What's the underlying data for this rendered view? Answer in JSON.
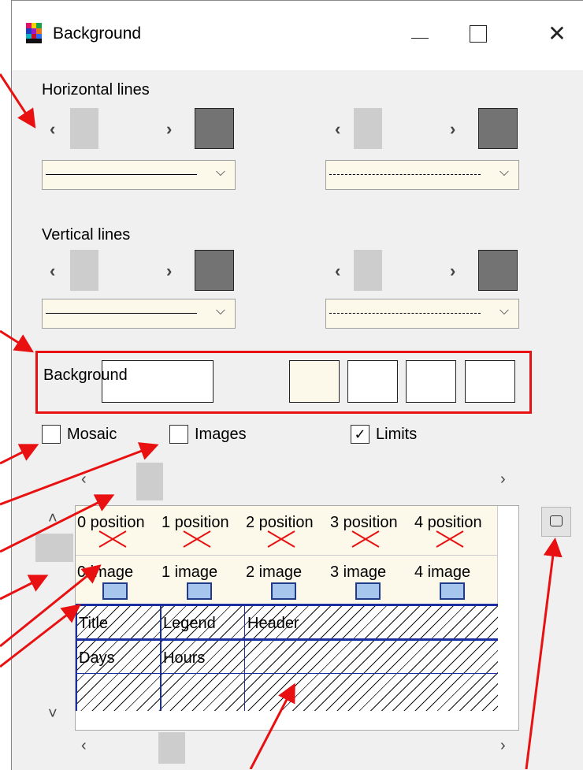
{
  "window": {
    "title": "Background"
  },
  "sections": {
    "horizontal_label": "Horizontal lines",
    "vertical_label": "Vertical lines",
    "background_label": "Background"
  },
  "checkboxes": {
    "mosaic": {
      "label": "Mosaic",
      "checked": false
    },
    "images": {
      "label": "Images",
      "checked": false
    },
    "limits": {
      "label": "Limits",
      "checked": true,
      "mark": "✓"
    }
  },
  "arrows": {
    "left": "‹",
    "right": "›",
    "up": "˄",
    "down": "˅",
    "chevron": "⌵"
  },
  "grid": {
    "position_row": [
      "0 position",
      "1 position",
      "2 position",
      "3 position",
      "4 position"
    ],
    "image_row": [
      "0 image",
      "1 image",
      "2 image",
      "3 image",
      "4 image"
    ],
    "text_rows": [
      [
        "Title",
        "Legend",
        "Header",
        "",
        ""
      ],
      [
        "Days",
        "Hours",
        "",
        "",
        ""
      ]
    ]
  },
  "colors": {
    "accent_red": "#e81010",
    "swatch_gray": "#737373",
    "combo_fill": "#fdf9ea",
    "grid_line_blue": "#1a2ea0"
  },
  "icons": {
    "app": "app-icon",
    "minimize": "minimize-icon",
    "maximize": "maximize-icon",
    "close": "close-icon",
    "side_button": "window-icon"
  }
}
